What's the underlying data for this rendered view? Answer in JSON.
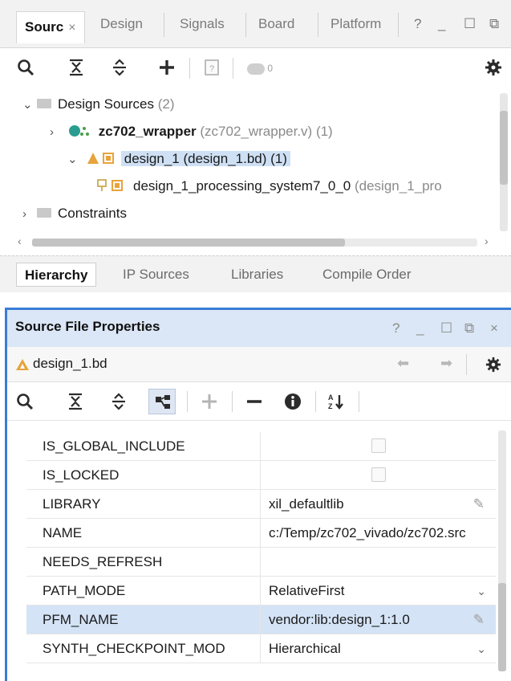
{
  "sources_panel": {
    "tabs": [
      {
        "label": "Sourc",
        "close": "×"
      },
      {
        "label": "Design"
      },
      {
        "label": "Signals"
      },
      {
        "label": "Board"
      },
      {
        "label": "Platform"
      }
    ],
    "window_buttons": {
      "help": "?",
      "minimize": "_",
      "maximize": "☐",
      "float": "⧉"
    },
    "toolbar": {
      "icons": [
        "search-icon",
        "collapse-all-icon",
        "expand-all-icon",
        "add-icon",
        "properties-icon",
        "toggle-icon",
        "settings-icon"
      ],
      "badge_count": "0"
    },
    "tree": [
      {
        "label": "Design Sources",
        "count": "(2)"
      },
      {
        "label": "zc702_wrapper",
        "detail": "(zc702_wrapper.v) (1)"
      },
      {
        "label": "design_1 (design_1.bd) (1)"
      },
      {
        "label": "design_1_processing_system7_0_0",
        "detail": "(design_1_pro"
      },
      {
        "label": "Constraints"
      }
    ],
    "bottom_tabs": [
      "Hierarchy",
      "IP Sources",
      "Libraries",
      "Compile Order"
    ]
  },
  "properties_panel": {
    "title": "Source File Properties",
    "window_buttons": {
      "help": "?",
      "minimize": "_",
      "maximize": "☐",
      "float": "⧉",
      "close": "×"
    },
    "object_name": "design_1.bd",
    "toolbar_icons": [
      "search-icon",
      "collapse-all-icon",
      "expand-all-icon",
      "show-hierarchy-icon",
      "add-icon",
      "remove-icon",
      "info-icon",
      "sort-icon"
    ],
    "rows": [
      {
        "name": "IS_GLOBAL_INCLUDE",
        "value": "",
        "type": "checkbox"
      },
      {
        "name": "IS_LOCKED",
        "value": "",
        "type": "checkbox"
      },
      {
        "name": "LIBRARY",
        "value": "xil_defaultlib",
        "type": "editable"
      },
      {
        "name": "NAME",
        "value": "c:/Temp/zc702_vivado/zc702.src",
        "type": "text"
      },
      {
        "name": "NEEDS_REFRESH",
        "value": "",
        "type": "text"
      },
      {
        "name": "PATH_MODE",
        "value": "RelativeFirst",
        "type": "dropdown"
      },
      {
        "name": "PFM_NAME",
        "value": "vendor:lib:design_1:1.0",
        "type": "editable",
        "selected": true
      },
      {
        "name": "SYNTH_CHECKPOINT_MOD",
        "value": "Hierarchical",
        "type": "dropdown"
      }
    ]
  },
  "colors": {
    "accent": "#3a7cd6",
    "selection": "#cfe0f4",
    "title_bar": "#dbe7f6",
    "teal": "#2a9d8f",
    "orange": "#e8a33c"
  }
}
